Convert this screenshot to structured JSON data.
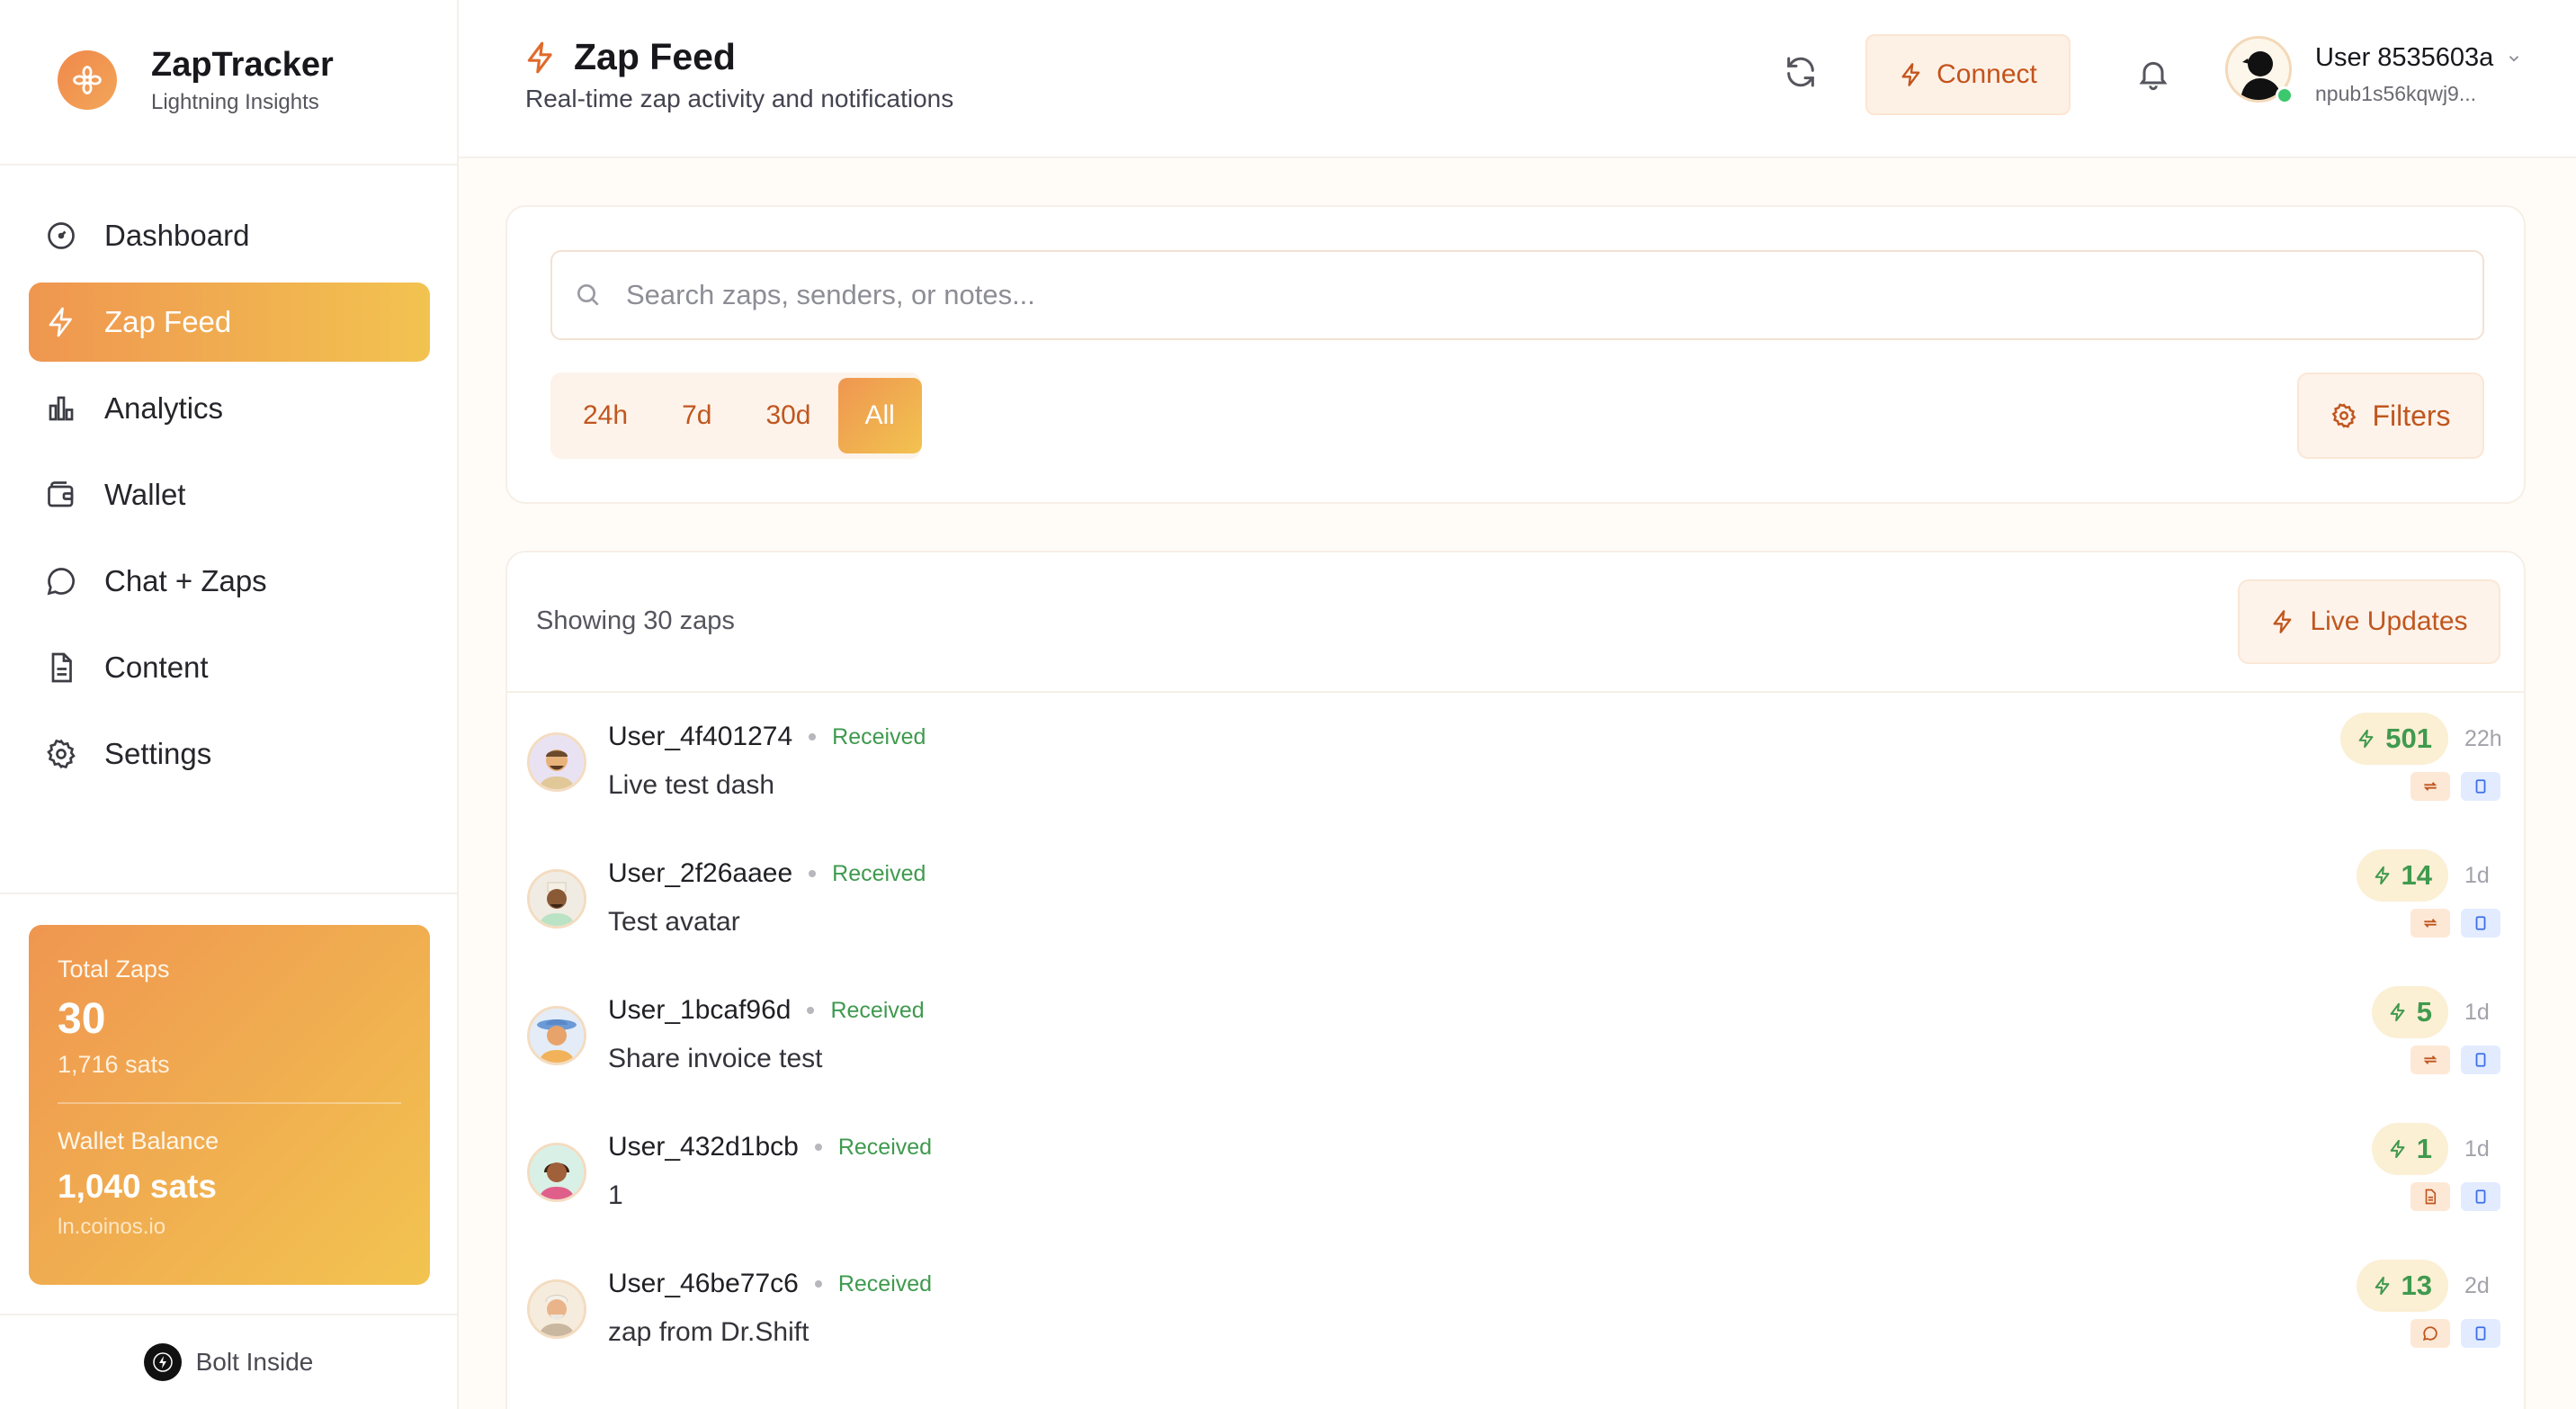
{
  "brand": {
    "name": "ZapTracker",
    "tagline": "Lightning Insights"
  },
  "nav": [
    {
      "label": "Dashboard",
      "icon": "gauge-icon",
      "active": false
    },
    {
      "label": "Zap Feed",
      "icon": "bolt-icon",
      "active": true
    },
    {
      "label": "Analytics",
      "icon": "bar-chart-icon",
      "active": false
    },
    {
      "label": "Wallet",
      "icon": "wallet-icon",
      "active": false
    },
    {
      "label": "Chat + Zaps",
      "icon": "chat-icon",
      "active": false
    },
    {
      "label": "Content",
      "icon": "document-icon",
      "active": false
    },
    {
      "label": "Settings",
      "icon": "gear-icon",
      "active": false
    }
  ],
  "stats": {
    "total_label": "Total Zaps",
    "total_value": "30",
    "total_sats": "1,716 sats",
    "wallet_label": "Wallet Balance",
    "wallet_value": "1,040 sats",
    "wallet_host": "ln.coinos.io"
  },
  "footer": {
    "label": "Bolt Inside"
  },
  "header": {
    "title": "Zap Feed",
    "subtitle": "Real-time zap activity and notifications",
    "connect_label": "Connect",
    "user_name": "User 8535603a",
    "user_npub": "npub1s56kqwj9..."
  },
  "search": {
    "placeholder": "Search zaps, senders, or notes..."
  },
  "ranges": [
    {
      "label": "24h",
      "active": false
    },
    {
      "label": "7d",
      "active": false
    },
    {
      "label": "30d",
      "active": false
    },
    {
      "label": "All",
      "active": true
    }
  ],
  "filters_label": "Filters",
  "feed": {
    "count_label": "Showing 30 zaps",
    "live_label": "Live Updates",
    "items": [
      {
        "sender": "User_4f401274",
        "status": "Received",
        "note": "Live test dash",
        "amount": "501",
        "time": "22h",
        "type_icon": "repost-icon"
      },
      {
        "sender": "User_2f26aaee",
        "status": "Received",
        "note": "Test avatar",
        "amount": "14",
        "time": "1d",
        "type_icon": "repost-icon"
      },
      {
        "sender": "User_1bcaf96d",
        "status": "Received",
        "note": "Share invoice test",
        "amount": "5",
        "time": "1d",
        "type_icon": "repost-icon"
      },
      {
        "sender": "User_432d1bcb",
        "status": "Received",
        "note": "1",
        "amount": "1",
        "time": "1d",
        "type_icon": "document-icon"
      },
      {
        "sender": "User_46be77c6",
        "status": "Received",
        "note": "zap from Dr.Shift",
        "amount": "13",
        "time": "2d",
        "type_icon": "chat-icon"
      }
    ]
  },
  "colors": {
    "accent_start": "#ef9650",
    "accent_end": "#f2c350",
    "accent_text": "#c0561f",
    "received_green": "#3f9a4e"
  }
}
